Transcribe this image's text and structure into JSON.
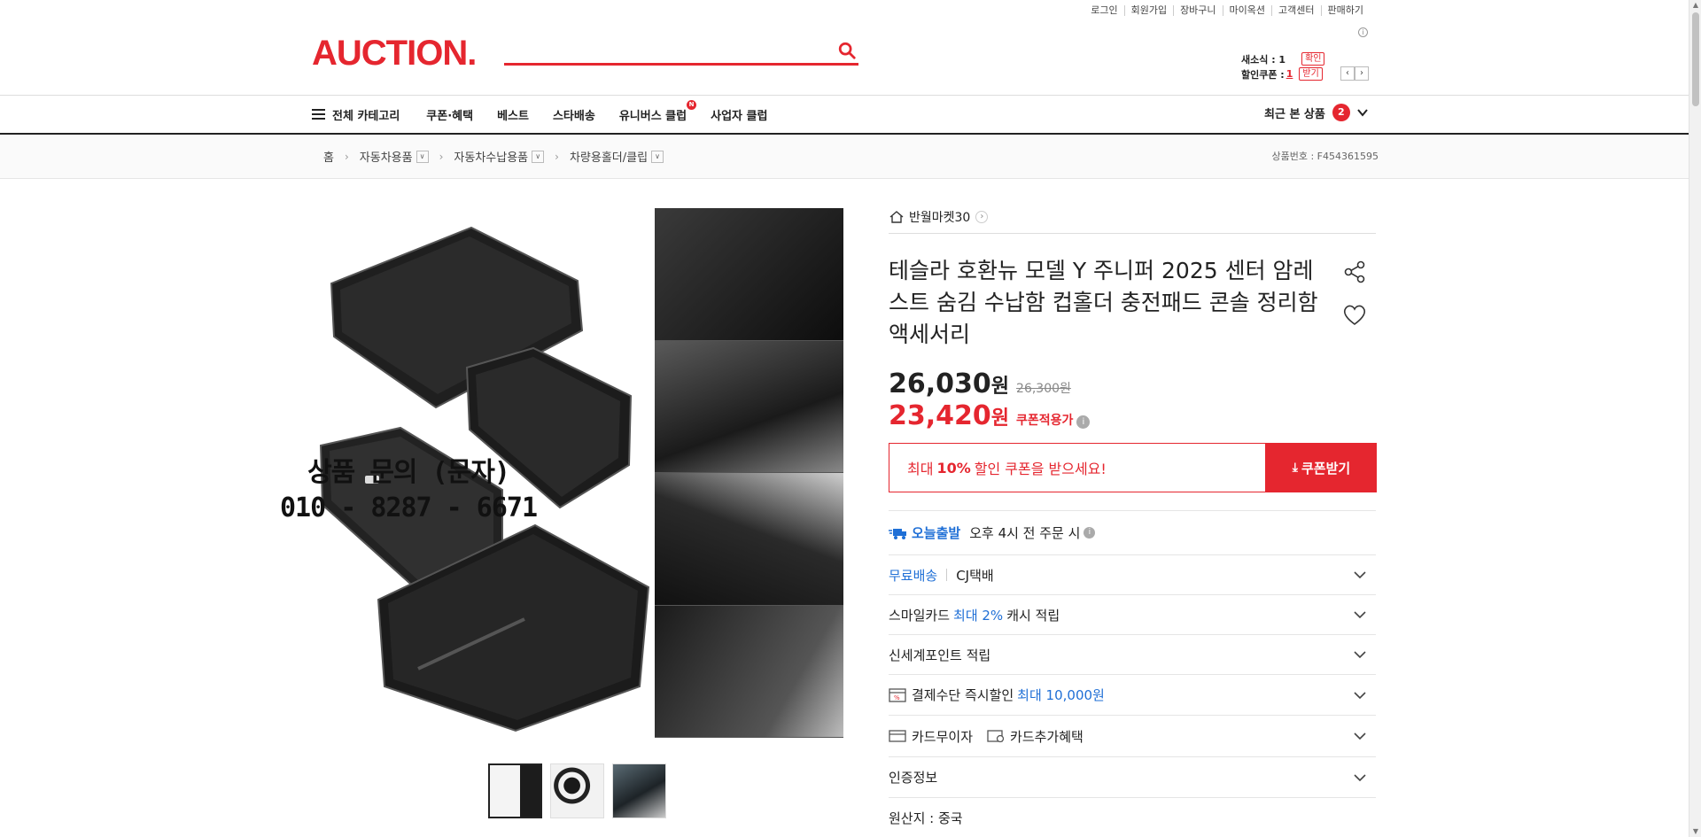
{
  "util_links": [
    "로그인",
    "회원가입",
    "장바구니",
    "마이옥션",
    "고객센터",
    "판매하기"
  ],
  "logo": "AUCTION.",
  "search": {
    "placeholder": ""
  },
  "mini": {
    "new_msg_label": "새소식 : 1",
    "new_msg_btn": "확인",
    "coupon_label": "할인쿠폰 : ",
    "coupon_num": "1",
    "coupon_btn": "받기"
  },
  "gnb": {
    "all_categories": "전체 카테고리",
    "items": [
      "쿠폰·혜택",
      "베스트",
      "스타배송",
      "유니버스 클럽",
      "사업자 클럽"
    ],
    "universe_badge": "N",
    "recent_label": "최근 본 상품",
    "recent_count": "2"
  },
  "breadcrumb": {
    "home": "홈",
    "levels": [
      "자동차용품",
      "자동차수납용품",
      "차량용홀더/클립"
    ]
  },
  "product_number": "상품번호 : F454361595",
  "gallery": {
    "watermark_line1": "상품 문의 (문자)",
    "watermark_line2": "010 - 8287 - 6671"
  },
  "seller": "반월마켓30",
  "title": "테슬라 호환뉴 모델 Y 주니퍼 2025 센터 암레스트 숨김 수납함 컵홀더 충전패드 콘솔 정리함 액세서리",
  "price": {
    "sale": "26,030",
    "original": "26,300원",
    "coupon": "23,420",
    "currency": "원",
    "coupon_label": "쿠폰적용가"
  },
  "coupon_banner": {
    "prefix": "최대",
    "percent": "10%",
    "suffix": "할인 쿠폰을 받으세요!",
    "button": "쿠폰받기"
  },
  "delivery": {
    "fast_label": "오늘출발",
    "fast_text": "오후 4시 전 주문 시",
    "free_label": "무료배송",
    "courier": "CJ택배"
  },
  "rows": {
    "smile_prefix": "스마일카드",
    "smile_highlight": "최대 2%",
    "smile_suffix": "캐시 적립",
    "shinsegae": "신세계포인트 적립",
    "pay_prefix": "결제수단 즉시할인",
    "pay_highlight": "최대 10,000원",
    "card_nointerest": "카드무이자",
    "card_extra": "카드추가혜택",
    "cert": "인증정보"
  },
  "origin": "원산지 : 중국",
  "colors": {
    "brand_red": "#e5262f",
    "link_blue": "#1f6fd6"
  }
}
